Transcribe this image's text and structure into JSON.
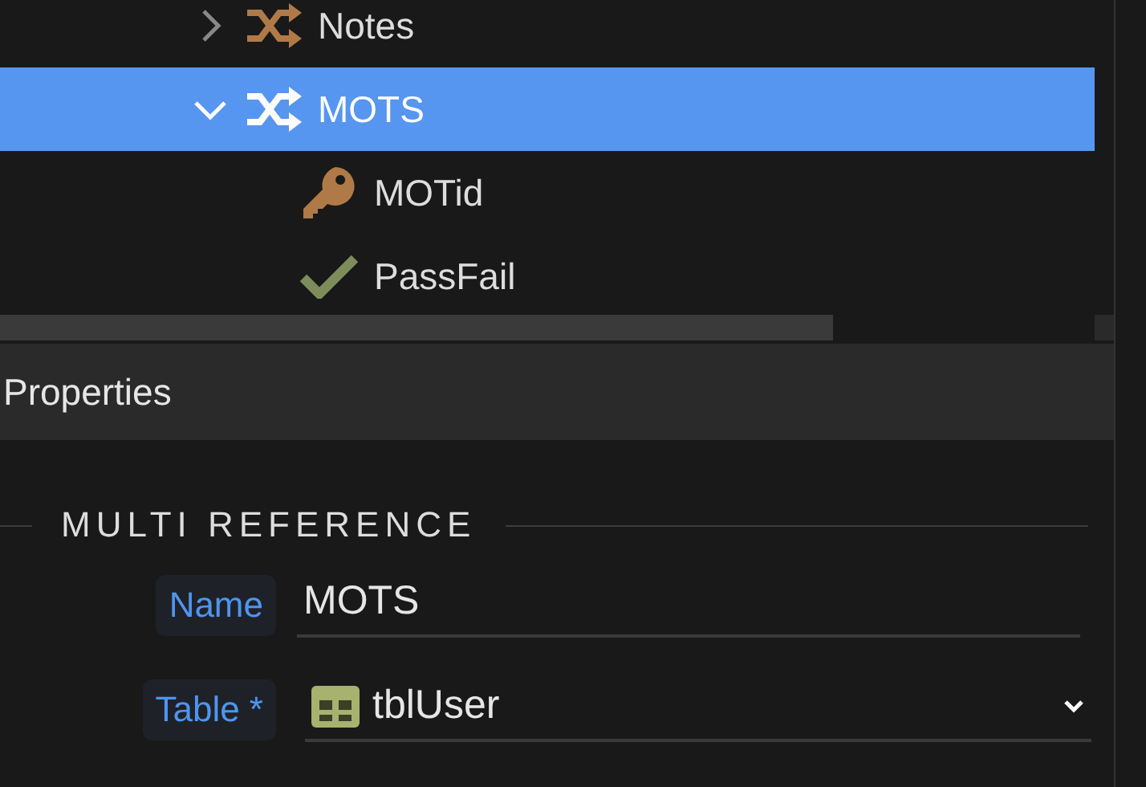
{
  "tree": {
    "items": [
      {
        "label": "Notes",
        "kind": "relation",
        "expanded": false,
        "selected": false
      },
      {
        "label": "MOTS",
        "kind": "relation",
        "expanded": true,
        "selected": true,
        "children": [
          {
            "label": "MOTid",
            "kind": "key",
            "selected": false
          },
          {
            "label": "PassFail",
            "kind": "boolean",
            "selected": false
          }
        ]
      }
    ]
  },
  "properties": {
    "title": "Properties",
    "section": "MULTI REFERENCE",
    "fields": [
      {
        "kind": "text",
        "label": "Name",
        "value": "MOTS"
      },
      {
        "kind": "select",
        "label": "Table *",
        "value": "tblUser"
      }
    ]
  }
}
